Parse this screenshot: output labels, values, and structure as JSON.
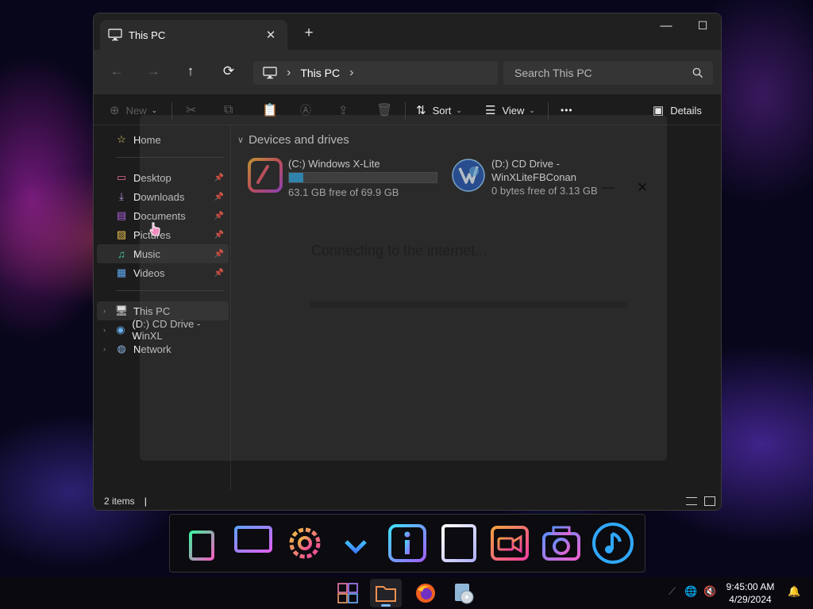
{
  "window": {
    "tab_title": "This PC",
    "new_tab": "+",
    "close_tab": "✕",
    "minimize": "—",
    "maximize": "☐",
    "close": "✕"
  },
  "nav": {
    "back": "←",
    "forward": "→",
    "up": "↑",
    "refresh": "⟳",
    "breadcrumb": "This PC",
    "search_placeholder": "Search This PC"
  },
  "commands": {
    "new": "New",
    "sort": "Sort",
    "view": "View",
    "more": "•••",
    "details": "Details"
  },
  "sidebar": {
    "home": "Home",
    "pinned": [
      {
        "label": "Desktop",
        "icon": "desktop-icon"
      },
      {
        "label": "Downloads",
        "icon": "downloads-icon"
      },
      {
        "label": "Documents",
        "icon": "documents-icon"
      },
      {
        "label": "Pictures",
        "icon": "pictures-icon"
      },
      {
        "label": "Music",
        "icon": "music-icon"
      },
      {
        "label": "Videos",
        "icon": "videos-icon"
      }
    ],
    "tree": [
      {
        "label": "This PC",
        "icon": "pc-icon"
      },
      {
        "label": "(D:) CD Drive - WinXL",
        "icon": "cd-drive-icon"
      },
      {
        "label": "Network",
        "icon": "network-icon"
      }
    ]
  },
  "content": {
    "group_title": "Devices and drives",
    "drives": [
      {
        "name": "(C:) Windows X-Lite",
        "free": "63.1 GB free of 69.9 GB",
        "used_fraction": 0.097
      },
      {
        "name_line1": "(D:) CD Drive -",
        "name_line2": "WinXLiteFBConan",
        "free": "0 bytes free of 3.13 GB"
      }
    ]
  },
  "overlay": {
    "message": "Connecting to the internet...",
    "minimize": "—",
    "close": "✕"
  },
  "status": {
    "items": "2 items",
    "sep": "|"
  },
  "clock": {
    "time": "9:45:00 AM",
    "date": "4/29/2024"
  },
  "colors": {
    "accent": "#26a0da",
    "window_bg": "#1c1c1c",
    "nav_bg": "#2c2c2c"
  }
}
